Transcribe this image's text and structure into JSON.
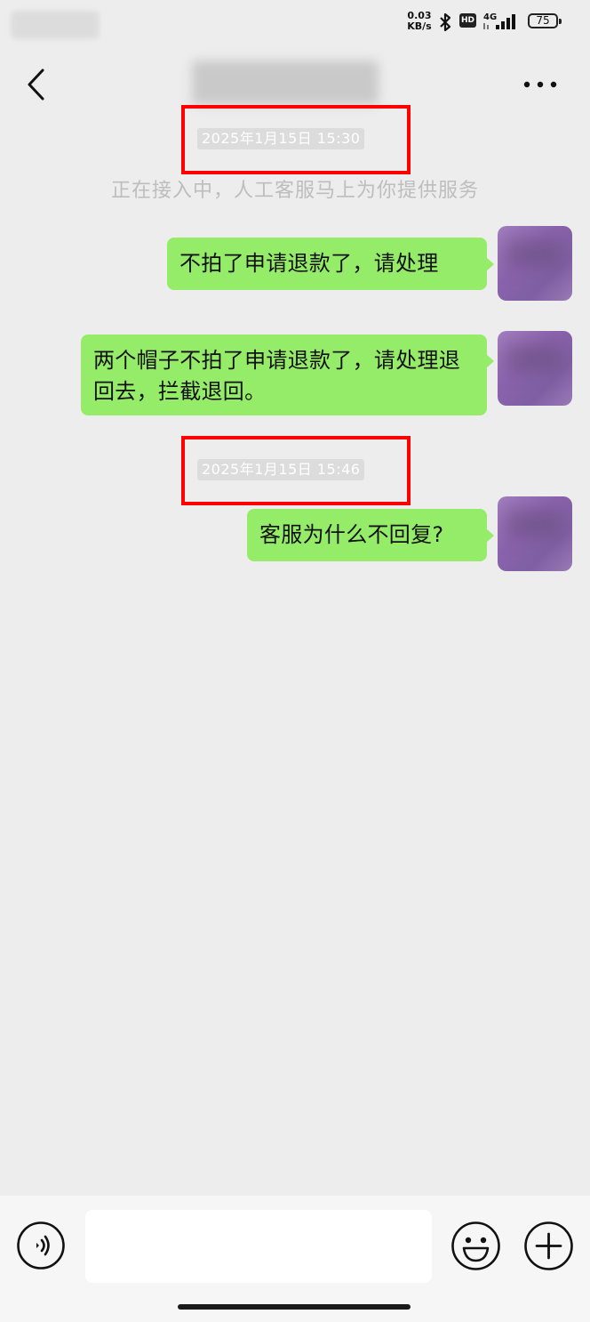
{
  "status_bar": {
    "net_speed_value": "0.03",
    "net_speed_unit": "KB/s",
    "hd_label": "HD",
    "network_label": "4G",
    "battery_level": "75",
    "icons": [
      "bluetooth-icon",
      "hd-icon",
      "signal-icon",
      "battery-icon"
    ]
  },
  "header": {
    "back_icon": "back-icon",
    "more_icon": "more-icon"
  },
  "chat": {
    "timestamp_1": "2025年1月15日 15:30",
    "system_notice": "正在接入中，人工客服马上为你提供服务",
    "messages": [
      {
        "sender": "me",
        "text": "不拍了申请退款了，请处理"
      },
      {
        "sender": "me",
        "text": "两个帽子不拍了申请退款了，请处理退回去，拦截退回。"
      },
      {
        "sender": "me",
        "text": "客服为什么不回复?"
      }
    ],
    "timestamp_2": "2025年1月15日 15:46"
  },
  "input_bar": {
    "voice_icon": "voice-icon",
    "input_value": "",
    "emoji_icon": "emoji-icon",
    "plus_icon": "plus-icon"
  },
  "colors": {
    "background": "#ededed",
    "bubble_green": "#95ec69",
    "highlight_red": "#ff0000"
  }
}
